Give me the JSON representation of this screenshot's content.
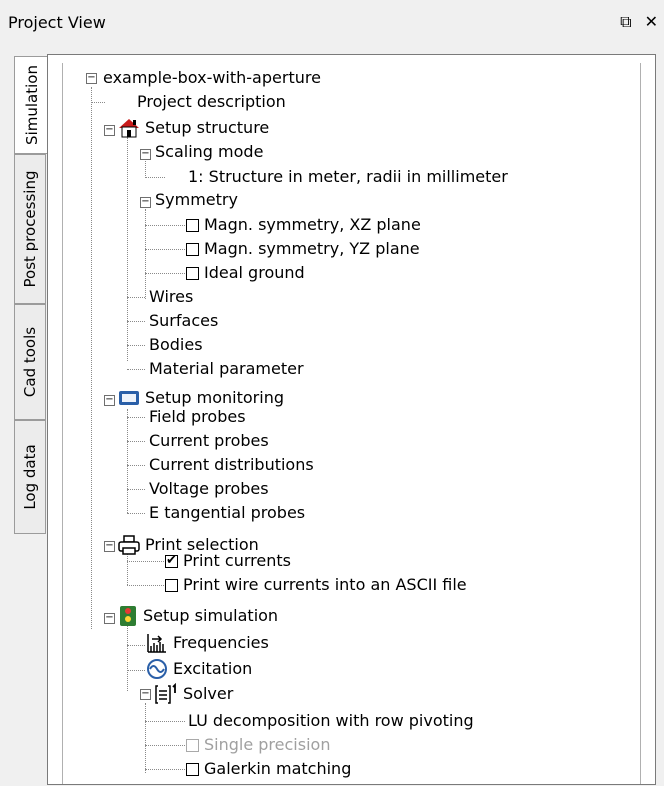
{
  "window": {
    "title": "Project View",
    "float_icon": "⧉",
    "close_icon": "✕"
  },
  "tabs": [
    {
      "label": "Simulation",
      "active": true
    },
    {
      "label": "Post processing",
      "active": false
    },
    {
      "label": "Cad tools",
      "active": false
    },
    {
      "label": "Log data",
      "active": false
    }
  ],
  "tree": {
    "root": "example-box-with-aperture",
    "project_description": "Project description",
    "setup_structure": {
      "label": "Setup structure",
      "scaling_mode": {
        "label": "Scaling mode",
        "value": "1: Structure in meter, radii in millimeter"
      },
      "symmetry": {
        "label": "Symmetry",
        "items": [
          {
            "label": "Magn. symmetry, XZ plane",
            "checked": false
          },
          {
            "label": "Magn. symmetry, YZ plane",
            "checked": false
          },
          {
            "label": "Ideal ground",
            "checked": false
          }
        ]
      },
      "items": [
        "Wires",
        "Surfaces",
        "Bodies",
        "Material parameter"
      ]
    },
    "setup_monitoring": {
      "label": "Setup monitoring",
      "items": [
        "Field probes",
        "Current probes",
        "Current distributions",
        "Voltage probes",
        "E tangential probes"
      ]
    },
    "print_selection": {
      "label": "Print selection",
      "items": [
        {
          "label": "Print currents",
          "checked": true
        },
        {
          "label": "Print wire currents into an ASCII file",
          "checked": false
        }
      ]
    },
    "setup_simulation": {
      "label": "Setup simulation",
      "frequencies": "Frequencies",
      "excitation": "Excitation",
      "solver": {
        "label": "Solver",
        "method": "LU decomposition with row pivoting",
        "single_precision": {
          "label": "Single precision",
          "checked": false,
          "disabled": true
        },
        "galerkin": {
          "label": "Galerkin matching",
          "checked": false
        }
      }
    }
  },
  "icons": [
    "house-icon",
    "monitor-icon",
    "printer-icon",
    "traffic-light-icon",
    "frequency-chart-icon",
    "wave-icon",
    "solver-doc-icon"
  ]
}
